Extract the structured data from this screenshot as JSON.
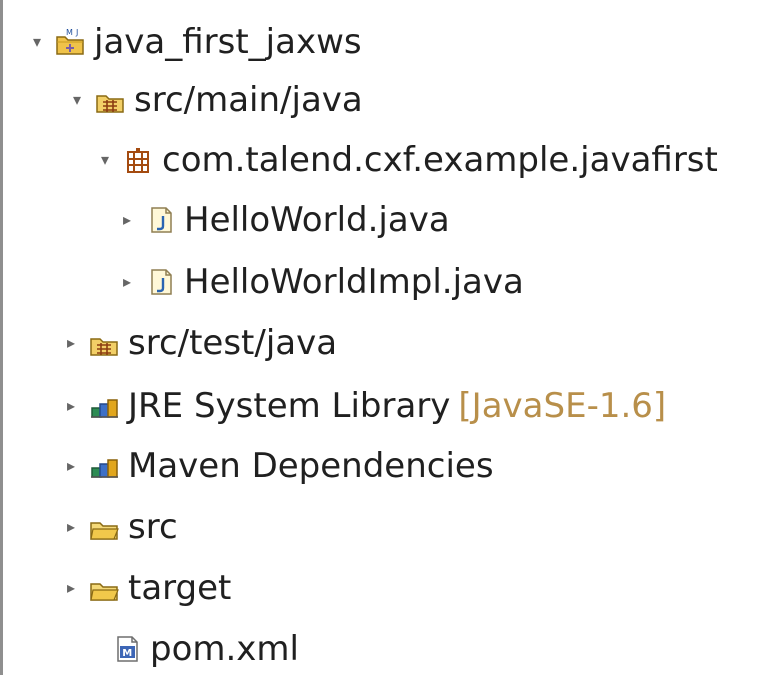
{
  "tree": {
    "items": [
      {
        "label": "java_first_jaxws",
        "expanded": true,
        "icon": "maven-project-icon",
        "decoration": ""
      },
      {
        "label": "src/main/java",
        "expanded": true,
        "icon": "source-folder-icon",
        "decoration": ""
      },
      {
        "label": "com.talend.cxf.example.javafirst",
        "expanded": true,
        "icon": "package-icon",
        "decoration": ""
      },
      {
        "label": "HelloWorld.java",
        "expanded": false,
        "icon": "java-file-icon",
        "decoration": ""
      },
      {
        "label": "HelloWorldImpl.java",
        "expanded": false,
        "icon": "java-file-icon",
        "decoration": ""
      },
      {
        "label": "src/test/java",
        "expanded": false,
        "icon": "source-folder-icon",
        "decoration": ""
      },
      {
        "label": "JRE System Library",
        "expanded": false,
        "icon": "library-icon",
        "decoration": "[JavaSE-1.6]"
      },
      {
        "label": "Maven Dependencies",
        "expanded": false,
        "icon": "library-icon",
        "decoration": ""
      },
      {
        "label": "src",
        "expanded": false,
        "icon": "folder-icon",
        "decoration": ""
      },
      {
        "label": "target",
        "expanded": false,
        "icon": "folder-icon",
        "decoration": ""
      },
      {
        "label": "pom.xml",
        "expanded": null,
        "icon": "maven-file-icon",
        "decoration": ""
      }
    ]
  },
  "colors": {
    "text": "#202020",
    "decoration": "#b88f4a",
    "twisty": "#666666"
  },
  "glyphs": {
    "expanded": "▾",
    "collapsed": "▸"
  }
}
